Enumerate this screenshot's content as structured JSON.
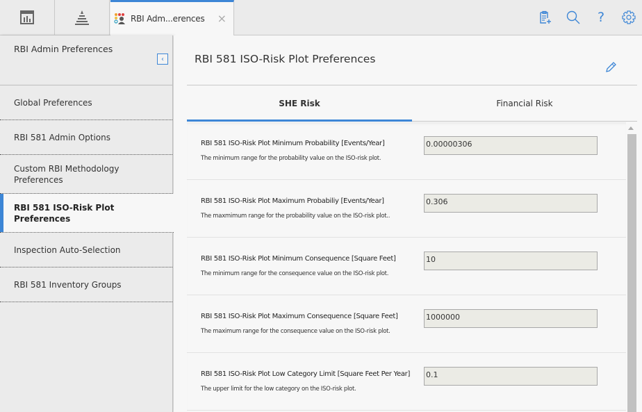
{
  "topbar": {
    "nav_buttons": [
      {
        "icon": "dashboard-icon"
      },
      {
        "icon": "asset-hierarchy-icon"
      }
    ],
    "active_tab": {
      "label": "RBI Adm...erences",
      "icon": "admin-preferences-icon",
      "close": "×"
    },
    "actions": [
      {
        "icon": "new-record-icon"
      },
      {
        "icon": "search-icon"
      },
      {
        "icon": "help-icon",
        "glyph": "?"
      },
      {
        "icon": "gear-icon"
      }
    ],
    "accent": "#3d86d6"
  },
  "sidebar": {
    "title": "RBI Admin Preferences",
    "collapse_glyph": "‹",
    "items": [
      {
        "label": "Global Preferences"
      },
      {
        "label": "RBI 581 Admin Options"
      },
      {
        "label": "Custom RBI Methodology Preferences"
      },
      {
        "label": "RBI 581 ISO-Risk Plot Preferences",
        "active": true
      },
      {
        "label": "Inspection Auto-Selection"
      },
      {
        "label": "RBI 581 Inventory Groups"
      }
    ]
  },
  "main": {
    "title": "RBI 581 ISO-Risk Plot Preferences",
    "tabs": [
      {
        "label": "SHE Risk",
        "active": true
      },
      {
        "label": "Financial Risk",
        "active": false
      }
    ],
    "rows": [
      {
        "name": "RBI 581 ISO-Risk Plot Minimum Probability [Events/Year]",
        "desc": "The minimum range for the probability value on the ISO-risk plot.",
        "value": "0.00000306"
      },
      {
        "name": "RBI 581 ISO-Risk Plot Maximum Probabiliy [Events/Year]",
        "desc": "The maxmimum range for the probability value on the ISO-risk plot..",
        "value": "0.306"
      },
      {
        "name": "RBI 581 ISO-Risk Plot Minimum Consequence [Square Feet]",
        "desc": "The minimum range for the consequence value on the ISO-risk plot.",
        "value": "10"
      },
      {
        "name": "RBI 581 ISO-Risk Plot Maximum Consequence [Square Feet]",
        "desc": "The maximum range for the consequence value on the ISO-risk plot.",
        "value": "1000000"
      },
      {
        "name": "RBI 581 ISO-Risk Plot Low Category Limit [Square Feet Per Year]",
        "desc": "The upper limit for the low category on the ISO-risk plot.",
        "value": "0.1"
      }
    ]
  }
}
